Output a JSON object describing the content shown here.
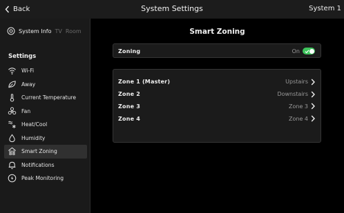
{
  "header": {
    "back_label": "Back",
    "title": "System Settings",
    "system_name": "System 1"
  },
  "sidebar": {
    "tabs": [
      {
        "label": "System Info",
        "icon": "settings-circle-icon",
        "active": true
      },
      {
        "label": "TV",
        "active": false
      },
      {
        "label": "Room",
        "active": false
      }
    ],
    "section_title": "Settings",
    "items": [
      {
        "label": "Wi-Fi",
        "icon": "wifi-icon",
        "selected": false
      },
      {
        "label": "Away",
        "icon": "leaf-icon",
        "selected": false
      },
      {
        "label": "Current Temperature",
        "icon": "thermometer-icon",
        "selected": false
      },
      {
        "label": "Fan",
        "icon": "fan-icon",
        "selected": false
      },
      {
        "label": "Heat/Cool",
        "icon": "heat-cool-icon",
        "selected": false
      },
      {
        "label": "Humidity",
        "icon": "droplet-icon",
        "selected": false
      },
      {
        "label": "Smart Zoning",
        "icon": "house-zones-icon",
        "selected": true
      },
      {
        "label": "Notifications",
        "icon": "bell-icon",
        "selected": false
      },
      {
        "label": "Peak Monitoring",
        "icon": "bolt-icon",
        "selected": false
      }
    ]
  },
  "main": {
    "title": "Smart Zoning",
    "zoning": {
      "label": "Zoning",
      "status": "On",
      "enabled": true
    },
    "zones": [
      {
        "label": "Zone 1 (Master)",
        "value": "Upstairs"
      },
      {
        "label": "Zone 2",
        "value": "Downstairs"
      },
      {
        "label": "Zone 3",
        "value": "Zone 3"
      },
      {
        "label": "Zone 4",
        "value": "Zone 4"
      }
    ]
  },
  "colors": {
    "accent_green": "#3ec45c",
    "background": "#000000",
    "panel": "#1b1b1b"
  }
}
